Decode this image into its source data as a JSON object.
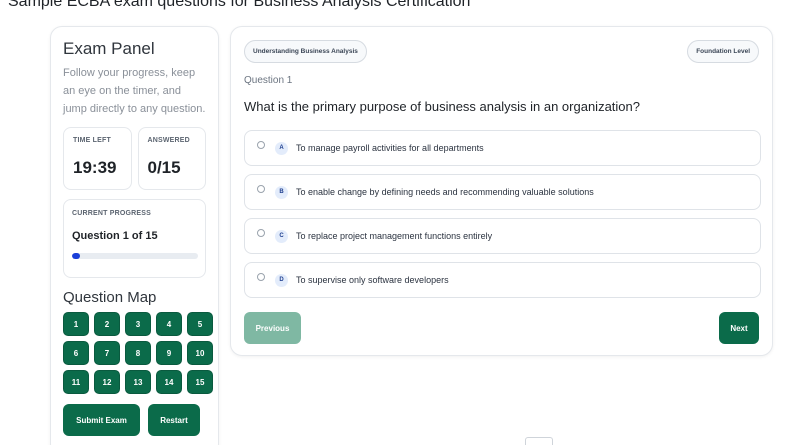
{
  "page": {
    "heading": "Sample ECBA exam questions for Business Analysis Certification"
  },
  "panel": {
    "title": "Exam Panel",
    "description": "Follow your progress, keep an eye on the timer, and jump directly to any question.",
    "time_left_label": "TIME LEFT",
    "time_left_value": "19:39",
    "answered_label": "ANSWERED",
    "answered_value": "0/15",
    "progress_label": "CURRENT PROGRESS",
    "progress_text": "Question 1 of 15",
    "progress_fraction": 0.067,
    "map_title": "Question Map",
    "question_numbers": [
      "1",
      "2",
      "3",
      "4",
      "5",
      "6",
      "7",
      "8",
      "9",
      "10",
      "11",
      "12",
      "13",
      "14",
      "15"
    ],
    "submit_label": "Submit Exam",
    "restart_label": "Restart"
  },
  "question": {
    "topic_tag": "Understanding Business Analysis",
    "level_tag": "Foundation Level",
    "number_label": "Question 1",
    "text": "What is the primary purpose of business analysis in an organization?",
    "options": [
      {
        "letter": "A",
        "text": "To manage payroll activities for all departments"
      },
      {
        "letter": "B",
        "text": "To enable change by defining needs and recommending valuable solutions"
      },
      {
        "letter": "C",
        "text": "To replace project management functions entirely"
      },
      {
        "letter": "D",
        "text": "To supervise only software developers"
      }
    ],
    "previous_label": "Previous",
    "next_label": "Next"
  },
  "colors": {
    "primary_green": "#0b6b4a",
    "disabled_green": "#7fb8a3",
    "progress_blue": "#1a3fd9"
  }
}
